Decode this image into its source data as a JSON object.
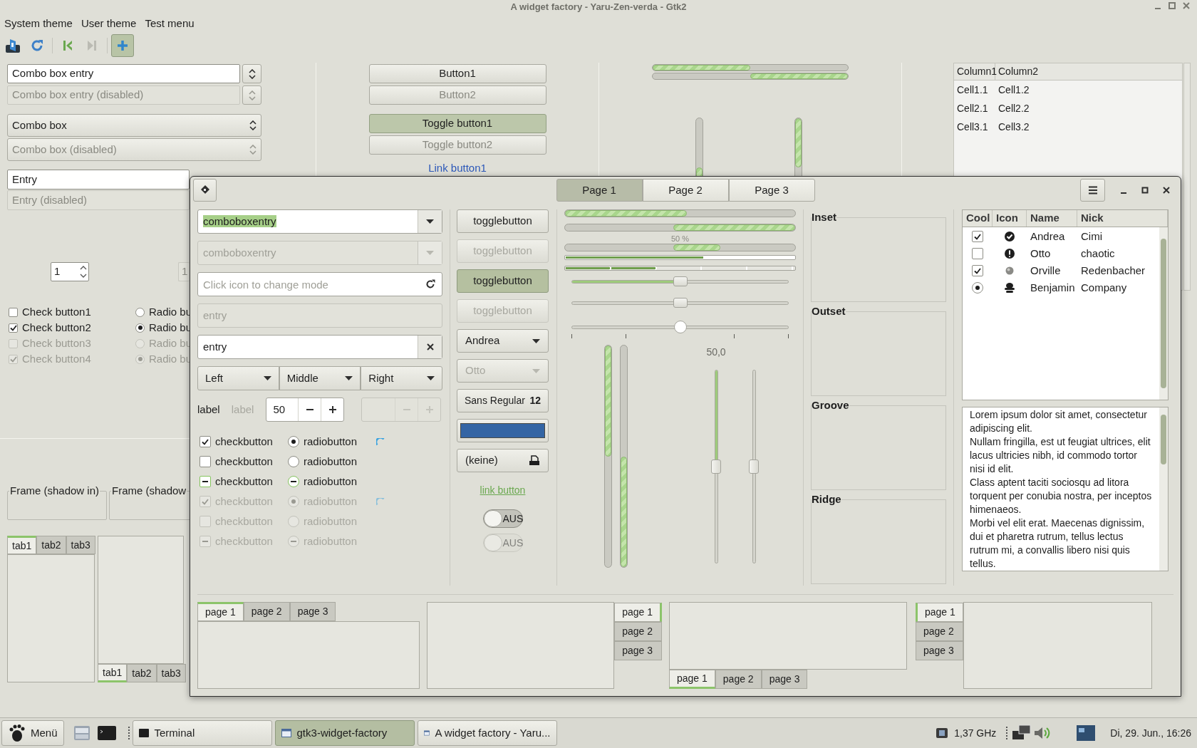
{
  "back_window": {
    "title": "A widget factory - Yaru-Zen-verda - Gtk2",
    "menu": [
      "System theme",
      "User theme",
      "Test menu"
    ],
    "toolbar": [
      {
        "kind": "theme",
        "disabled": false,
        "active": false
      },
      {
        "kind": "refresh",
        "disabled": false,
        "active": false
      },
      {
        "kind": "first",
        "disabled": false,
        "active": false
      },
      {
        "kind": "last",
        "disabled": true,
        "active": false
      },
      {
        "kind": "add",
        "disabled": false,
        "active": true
      }
    ],
    "combo_entries": [
      {
        "value": "Combo box entry",
        "disabled": false
      },
      {
        "value": "Combo box entry (disabled)",
        "disabled": true
      }
    ],
    "combos": [
      {
        "value": "Combo box",
        "disabled": false
      },
      {
        "value": "Combo box (disabled)",
        "disabled": true
      }
    ],
    "entries": [
      {
        "value": "Entry",
        "disabled": false
      },
      {
        "value": "Entry (disabled)",
        "disabled": true
      }
    ],
    "spins": [
      {
        "value": "1",
        "disabled": false
      },
      {
        "value": "1",
        "disabled": true
      }
    ],
    "check_buttons": [
      {
        "label": "Check button1",
        "checked": false,
        "disabled": false
      },
      {
        "label": "Check button2",
        "checked": true,
        "disabled": false
      },
      {
        "label": "Check button3",
        "checked": false,
        "disabled": true
      },
      {
        "label": "Check button4",
        "checked": true,
        "disabled": true
      }
    ],
    "radio_buttons": [
      {
        "label": "Radio bu",
        "selected": false,
        "disabled": false
      },
      {
        "label": "Radio bu",
        "selected": true,
        "disabled": false
      },
      {
        "label": "Radio bu",
        "selected": false,
        "disabled": true
      },
      {
        "label": "Radio bu",
        "selected": true,
        "disabled": true
      }
    ],
    "frames": [
      "Frame (shadow in)",
      "Frame (shadow"
    ],
    "notebooks": [
      {
        "kind": "top",
        "tabs": [
          {
            "label": "tab1",
            "selected": true
          },
          {
            "label": "tab2",
            "selected": false
          },
          {
            "label": "tab3",
            "selected": false
          }
        ]
      },
      {
        "kind": "bottom",
        "tabs": [
          {
            "label": "tab1",
            "selected": true
          },
          {
            "label": "tab2",
            "selected": false
          },
          {
            "label": "tab3",
            "selected": false
          }
        ]
      }
    ],
    "buttons": [
      {
        "label": "Button1",
        "disabled": false
      },
      {
        "label": "Button2",
        "disabled": true
      }
    ],
    "toggle_buttons": [
      {
        "label": "Toggle button1",
        "active": true,
        "disabled": false
      },
      {
        "label": "Toggle button2",
        "active": false,
        "disabled": true
      }
    ],
    "link_button": "Link button1",
    "progress_bars": [
      {
        "level": 0.5,
        "inverted": false
      },
      {
        "level": 0.5,
        "inverted": true
      }
    ],
    "vertical_progress_bars": [
      {
        "level": 0.5,
        "inverted": false
      },
      {
        "level": 0.5,
        "inverted": true
      }
    ],
    "tree": {
      "columns": [
        "Column1",
        "Column2"
      ],
      "rows": [
        [
          "Cell1.1",
          "Cell1.2"
        ],
        [
          "Cell2.1",
          "Cell2.2"
        ],
        [
          "Cell3.1",
          "Cell3.2"
        ]
      ]
    }
  },
  "front_window": {
    "header_tabs": [
      {
        "label": "Page 1",
        "selected": true
      },
      {
        "label": "Page 2",
        "selected": false
      },
      {
        "label": "Page 3",
        "selected": false
      }
    ],
    "combo_entries": [
      {
        "value": "comboboxentry",
        "disabled": false,
        "highlighted": true
      },
      {
        "value": "comboboxentry",
        "disabled": true,
        "highlighted": false
      }
    ],
    "mode_entry": {
      "placeholder": "Click icon to change mode"
    },
    "entries": [
      {
        "value": "entry",
        "disabled": true,
        "kind": "plain"
      },
      {
        "value": "entry",
        "disabled": false,
        "kind": "clearable"
      }
    ],
    "linked_combos": [
      "Left",
      "Middle",
      "Right"
    ],
    "labels": [
      {
        "text": "label",
        "disabled": false
      },
      {
        "text": "label",
        "disabled": true
      }
    ],
    "spins": [
      {
        "value": "50",
        "disabled": false
      },
      {
        "disabled": true
      }
    ],
    "check_rows": [
      {
        "check": {
          "label": "checkbutton",
          "checked": true,
          "inconsistent": false,
          "disabled": false
        },
        "radio": {
          "label": "radiobutton",
          "selected": true,
          "inconsistent": false,
          "disabled": false
        },
        "spinner": true
      },
      {
        "check": {
          "label": "checkbutton",
          "checked": false,
          "inconsistent": false,
          "disabled": false
        },
        "radio": {
          "label": "radiobutton",
          "selected": false,
          "inconsistent": false,
          "disabled": false
        },
        "spinner": false
      },
      {
        "check": {
          "label": "checkbutton",
          "checked": false,
          "inconsistent": true,
          "disabled": false
        },
        "radio": {
          "label": "radiobutton",
          "selected": false,
          "inconsistent": true,
          "disabled": false
        },
        "spinner": false
      },
      {
        "check": {
          "label": "checkbutton",
          "checked": true,
          "inconsistent": false,
          "disabled": true
        },
        "radio": {
          "label": "radiobutton",
          "selected": true,
          "inconsistent": false,
          "disabled": true
        },
        "spinner": true
      },
      {
        "check": {
          "label": "checkbutton",
          "checked": false,
          "inconsistent": false,
          "disabled": true
        },
        "radio": {
          "label": "radiobutton",
          "selected": false,
          "inconsistent": false,
          "disabled": true
        },
        "spinner": false
      },
      {
        "check": {
          "label": "checkbutton",
          "checked": false,
          "inconsistent": true,
          "disabled": true
        },
        "radio": {
          "label": "radiobutton",
          "selected": false,
          "inconsistent": true,
          "disabled": true
        },
        "spinner": false
      }
    ],
    "toggle_buttons": [
      {
        "label": "togglebutton",
        "active": false,
        "disabled": false
      },
      {
        "label": "togglebutton",
        "active": false,
        "disabled": true
      },
      {
        "label": "togglebutton",
        "active": true,
        "disabled": false
      },
      {
        "label": "togglebutton",
        "active": false,
        "disabled": true
      }
    ],
    "combos": [
      {
        "value": "Andrea",
        "disabled": false
      },
      {
        "value": "Otto",
        "disabled": true
      }
    ],
    "font_button": {
      "name": "Sans Regular",
      "size": "12"
    },
    "color_button": {
      "color": "#3465a4"
    },
    "file_button": {
      "label": "(keine)"
    },
    "link_button": "link button",
    "switches": [
      {
        "label": "AUS",
        "on": false,
        "disabled": false
      },
      {
        "label": "AUS",
        "on": false,
        "disabled": true
      }
    ],
    "progress_bars": [
      {
        "level": 0.53,
        "inverted": false
      },
      {
        "level": 0.53,
        "inverted": true
      }
    ],
    "pulse_bar": {
      "text": "50 %"
    },
    "level_bars": [
      {
        "level": 0.6,
        "kind": "continuous"
      },
      {
        "level": 0.4,
        "kind": "discrete"
      }
    ],
    "sliders": [
      {
        "level": 0.5,
        "kind": "fill"
      },
      {
        "level": 0.5,
        "kind": "plain"
      },
      {
        "level": 0.5,
        "kind": "marks"
      }
    ],
    "vertical_progress_bars": [
      {
        "level": 0.5,
        "inverted": true
      },
      {
        "level": 0.5,
        "inverted": false
      }
    ],
    "vertical_scales": [
      {
        "level": 0.5,
        "kind": "fill",
        "value": "50,0"
      },
      {
        "level": 0.5,
        "kind": "plain"
      }
    ],
    "frames": [
      "Inset",
      "Outset",
      "Groove",
      "Ridge"
    ],
    "tree": {
      "columns": [
        "Cool",
        "Icon",
        "Name",
        "Nick"
      ],
      "rows": [
        {
          "cool": {
            "kind": "check",
            "checked": true
          },
          "kind": "ok",
          "name": "Andrea",
          "nick": "Cimi"
        },
        {
          "cool": {
            "kind": "check",
            "checked": false
          },
          "kind": "warning",
          "name": "Otto",
          "nick": "chaotic"
        },
        {
          "cool": {
            "kind": "check",
            "checked": true
          },
          "kind": "sphere",
          "name": "Orville",
          "nick": "Redenbacher"
        },
        {
          "cool": {
            "kind": "radio",
            "checked": true
          },
          "kind": "figure",
          "name": "Benjamin",
          "nick": "Company"
        }
      ]
    },
    "text_view": [
      "Lorem ipsum dolor sit amet, consectetur adipiscing elit.",
      "Nullam fringilla, est ut feugiat ultrices, elit lacus ultricies nibh, id commodo tortor nisi id elit.",
      "Class aptent taciti sociosqu ad litora torquent per conubia nostra, per inceptos himenaeos.",
      "Morbi vel elit erat. Maecenas dignissim, dui et pharetra rutrum, tellus lectus rutrum mi, a convallis libero nisi quis tellus."
    ],
    "notebooks": [
      {
        "kind": "top",
        "tabs": [
          {
            "label": "page 1",
            "selected": true
          },
          {
            "label": "page 2",
            "selected": false
          },
          {
            "label": "page 3",
            "selected": false
          }
        ]
      },
      {
        "kind": "right",
        "tabs": [
          {
            "label": "page 1",
            "selected": true
          },
          {
            "label": "page 2",
            "selected": false
          },
          {
            "label": "page 3",
            "selected": false
          }
        ]
      },
      {
        "kind": "bottom",
        "tabs": [
          {
            "label": "page 1",
            "selected": true
          },
          {
            "label": "page 2",
            "selected": false
          },
          {
            "label": "page 3",
            "selected": false
          }
        ]
      },
      {
        "kind": "left",
        "tabs": [
          {
            "label": "page 1",
            "selected": true
          },
          {
            "label": "page 2",
            "selected": false
          },
          {
            "label": "page 3",
            "selected": false
          }
        ]
      }
    ]
  },
  "taskbar": {
    "menu": "Menü",
    "tasks": [
      {
        "label": "Terminal",
        "selected": false,
        "kind": "terminal"
      },
      {
        "label": "gtk3-widget-factory",
        "selected": true,
        "kind": "window"
      },
      {
        "label": "A widget factory - Yaru...",
        "selected": false,
        "kind": "window"
      }
    ],
    "cpu": "1,37 GHz",
    "clock": "Di, 29. Jun., 16:26"
  }
}
